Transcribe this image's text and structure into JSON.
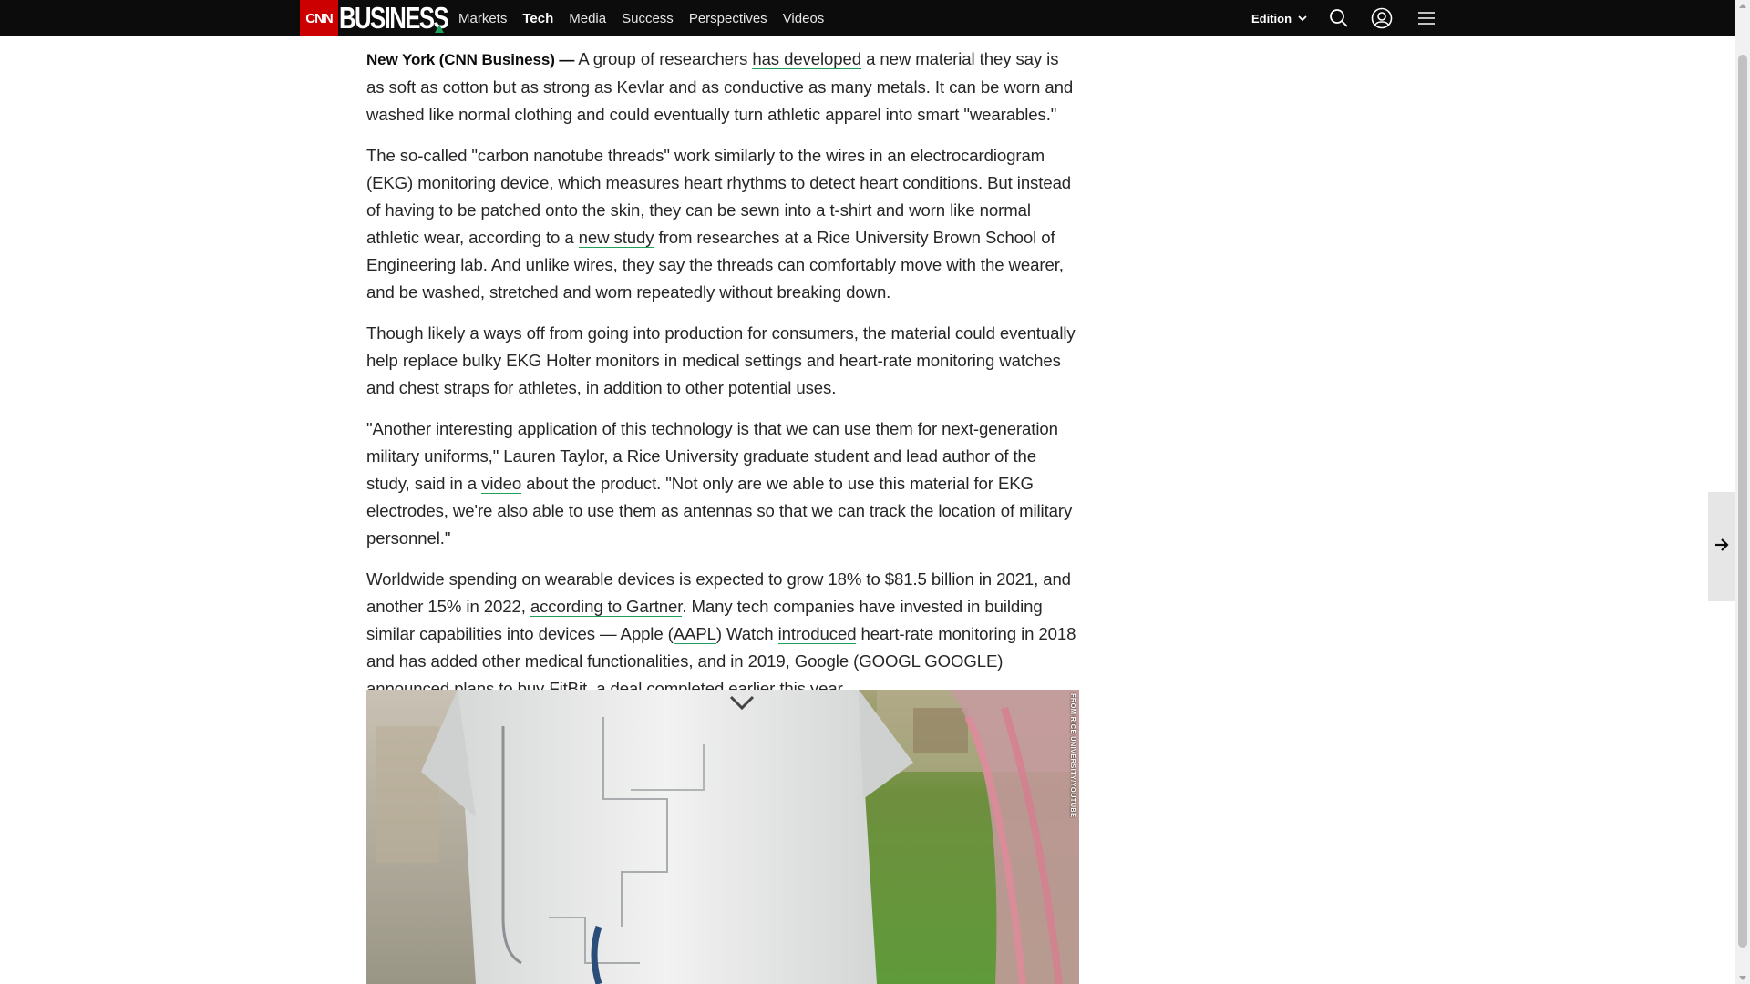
{
  "header": {
    "logo_cnn": "CNN",
    "logo_business": "BUSINESS",
    "nav": [
      {
        "label": "Markets",
        "active": false
      },
      {
        "label": "Tech",
        "active": true
      },
      {
        "label": "Media",
        "active": false
      },
      {
        "label": "Success",
        "active": false
      },
      {
        "label": "Perspectives",
        "active": false
      },
      {
        "label": "Videos",
        "active": false
      }
    ],
    "edition_label": "Edition",
    "icons": [
      "chevron-down-icon",
      "search-icon",
      "user-icon",
      "menu-icon"
    ]
  },
  "article": {
    "dateline": "New York (CNN Business) —",
    "p1": {
      "t1": " A group of researchers ",
      "link1": "has developed",
      "t2": " a new material they say is as soft as cotton but as strong as Kevlar and as conductive as many metals. It can be worn and washed like normal clothing and could eventually turn athletic apparel into smart \"wearables.\""
    },
    "p2": {
      "t1": "The so-called \"carbon nanotube threads\" work similarly to the wires in an electrocardiogram (EKG) monitoring device, which measures heart rhythms to detect heart conditions. But instead of having to be patched onto the skin, they can be sewn into a t-shirt and worn like normal athletic wear, according to a ",
      "link1": "new study",
      "t2": " from researches at a Rice University Brown School of Engineering lab. And unlike wires, they say the threads can comfortably move with the wearer, and be washed, stretched and worn repeatedly without breaking down."
    },
    "p3": "Though likely a ways off from going into production for consumers, the material could eventually help replace bulky EKG Holter monitors in medical settings and heart-rate monitoring watches and chest straps for athletes, in addition to other potential uses.",
    "p4": {
      "t1": "\"Another interesting application of this technology is that we can use them for next-generation military uniforms,\" Lauren Taylor, a Rice University graduate student and lead author of the study, said in a ",
      "link1": "video",
      "t2": " about the product. \"Not only are we able to use this material for EKG electrodes, we're also able to use them as antennas so that we can track the location of military personnel.\""
    },
    "p5": {
      "t1": "Worldwide spending on wearable devices is expected to grow 18% to $81.5 billion in 2021, and another 15% in 2022, ",
      "link1": "according to Gartner",
      "t2": ". Many tech companies have invested in building similar capabilities into devices — Apple (",
      "link2": "AAPL",
      "t3": ") Watch ",
      "link3": "introduced",
      "t4": " heart-rate monitoring in 2018 and has added other medical functionalities, and in 2019, Google (",
      "link4": "GOOGL GOOGLE",
      "t5": ") ",
      "link5": "announced",
      "t6": " plans to buy FitBit, a deal completed earlier this year."
    },
    "photo_credit": "FROM RICE UNIVERSITY/YOUTUBE"
  },
  "colors": {
    "accent": "#1fa05a",
    "brand_red": "#cc0000",
    "nav_bg": "#0c0c0c"
  }
}
